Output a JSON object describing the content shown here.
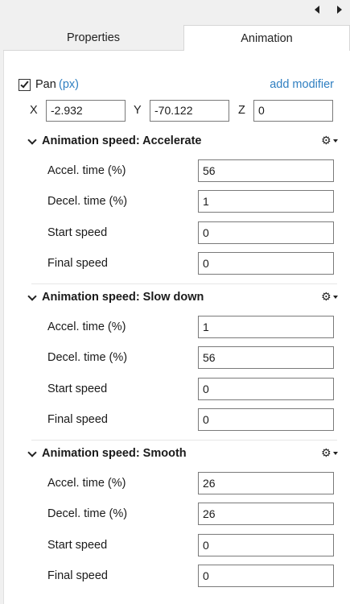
{
  "nav": {
    "prev_icon": "triangle-left",
    "next_icon": "triangle-right"
  },
  "tabs": [
    {
      "label": "Properties",
      "active": false
    },
    {
      "label": "Animation",
      "active": true
    }
  ],
  "pan": {
    "checked": true,
    "label": "Pan",
    "unit": "(px)",
    "add_modifier": "add modifier",
    "x_label": "X",
    "x_value": "-2.932",
    "y_label": "Y",
    "y_value": "-70.122",
    "z_label": "Z",
    "z_value": "0"
  },
  "sections": [
    {
      "title": "Animation speed: Accelerate",
      "props": [
        {
          "label": "Accel. time (%)",
          "value": "56"
        },
        {
          "label": "Decel. time (%)",
          "value": "1"
        },
        {
          "label": "Start speed",
          "value": "0"
        },
        {
          "label": "Final speed",
          "value": "0"
        }
      ]
    },
    {
      "title": "Animation speed: Slow down",
      "props": [
        {
          "label": "Accel. time (%)",
          "value": "1"
        },
        {
          "label": "Decel. time (%)",
          "value": "56"
        },
        {
          "label": "Start speed",
          "value": "0"
        },
        {
          "label": "Final speed",
          "value": "0"
        }
      ]
    },
    {
      "title": "Animation speed: Smooth",
      "props": [
        {
          "label": "Accel. time (%)",
          "value": "26"
        },
        {
          "label": "Decel. time (%)",
          "value": "26"
        },
        {
          "label": "Start speed",
          "value": "0"
        },
        {
          "label": "Final speed",
          "value": "0"
        }
      ]
    }
  ],
  "colors": {
    "link": "#2f7fc1",
    "panel_bg": "#ffffff",
    "chrome_bg": "#f0f0f0"
  }
}
